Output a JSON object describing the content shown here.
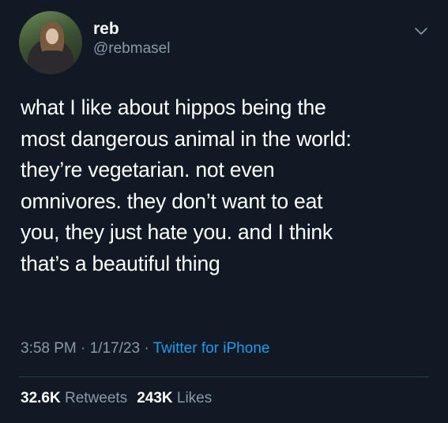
{
  "user": {
    "display_name": "reb",
    "handle": "@rebmasel",
    "avatar_icon": "profile-photo"
  },
  "menu": {
    "icon": "chevron-down-icon"
  },
  "tweet": {
    "text": "what I like about hippos being the\nmost dangerous animal in the world:\nthey’re vegetarian. not even\nomnivores. they don’t want to eat\nyou, they just hate you. and I think\nthat’s a beautiful thing",
    "time": "3:58 PM",
    "separator": " · ",
    "date": "1/17/23",
    "source": "Twitter for iPhone"
  },
  "stats": {
    "retweets_count": "32.6K",
    "retweets_label": "Retweets",
    "likes_count": "243K",
    "likes_label": "Likes"
  },
  "colors": {
    "background": "#111a24",
    "text": "#ffffff",
    "secondary": "#8b98a5",
    "link": "#1d9bf0"
  }
}
